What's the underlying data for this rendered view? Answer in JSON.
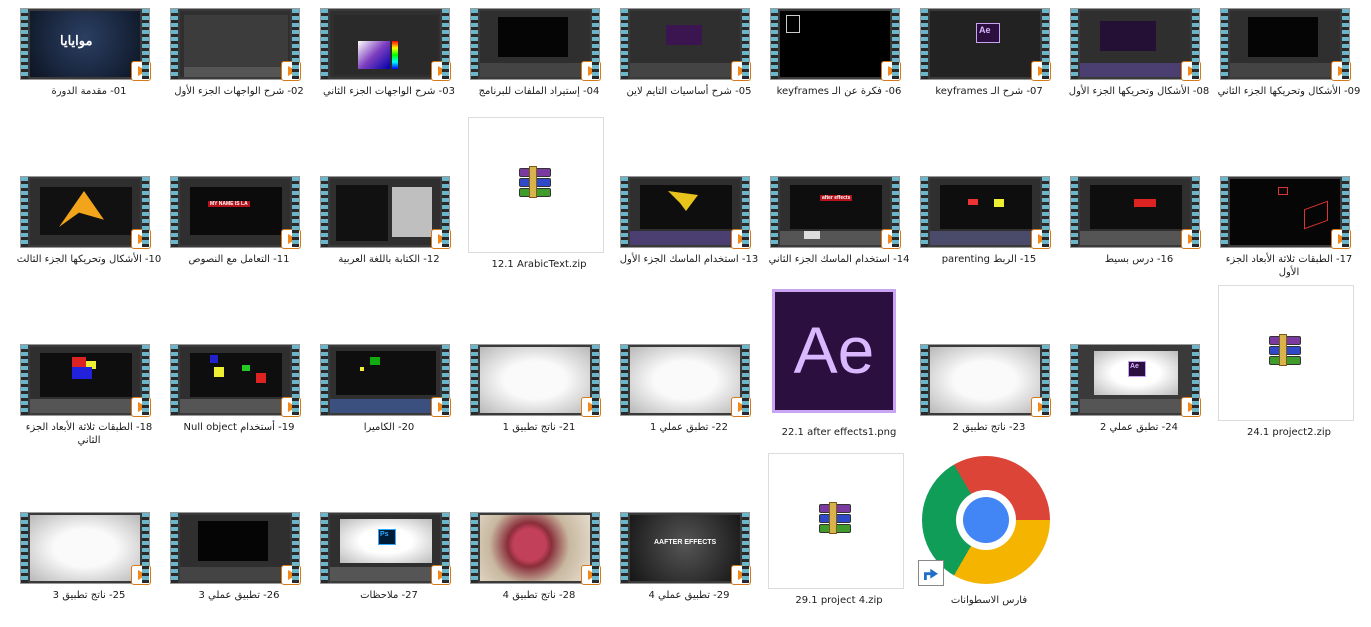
{
  "files": [
    {
      "name": "01- مقدمة الدورة",
      "type": "video",
      "theme": "title"
    },
    {
      "name": "02- شرح الواجهات الجزء الأول",
      "type": "video",
      "theme": "ui"
    },
    {
      "name": "03- شرح الواجهات الجزء الثاني",
      "type": "video",
      "theme": "color"
    },
    {
      "name": "04- إستيراد الملفات للبرنامج",
      "type": "video",
      "theme": "dark"
    },
    {
      "name": "05- شرح أساسيات التايم لاين",
      "type": "video",
      "theme": "purple"
    },
    {
      "name": "06- فكرة عن الـ keyframes",
      "type": "video",
      "theme": "black"
    },
    {
      "name": "07- شرح الـ keyframes",
      "type": "video",
      "theme": "ae"
    },
    {
      "name": "08- الأشكال وتحريكها الجزء الأول",
      "type": "video",
      "theme": "purple2"
    },
    {
      "name": "09- الأشكال وتحريكها الجزء الثاني",
      "type": "video",
      "theme": "dark"
    },
    {
      "name": "10- الأشكال وتحريكها الجزء الثالث",
      "type": "video",
      "theme": "yellow"
    },
    {
      "name": "11- التعامل مع النصوص",
      "type": "video",
      "theme": "redtext"
    },
    {
      "name": "12- الكتابة باللغة العربية",
      "type": "video",
      "theme": "gray"
    },
    {
      "name": "12.1 ArabicText.zip",
      "type": "zip"
    },
    {
      "name": "13- استخدام الماسك الجزء الأول",
      "type": "video",
      "theme": "yellow2"
    },
    {
      "name": "14- استخدام الماسك الجزء الثاني",
      "type": "video",
      "theme": "after"
    },
    {
      "name": "15- الربط parenting",
      "type": "video",
      "theme": "redyellow"
    },
    {
      "name": "16- درس بسيط",
      "type": "video",
      "theme": "redbar"
    },
    {
      "name": "17- الطبقات ثلاثة الأبعاد الجزء الأول",
      "type": "video",
      "theme": "3d"
    },
    {
      "name": "18- الطبقات ثلاثة الأبعاد الجزء الثاني",
      "type": "video",
      "theme": "blocks"
    },
    {
      "name": "19- أستخدام Null object",
      "type": "video",
      "theme": "blocks2"
    },
    {
      "name": "20- الكاميرا",
      "type": "video",
      "theme": "green"
    },
    {
      "name": "21- ناتج تطبيق 1",
      "type": "video",
      "theme": "white"
    },
    {
      "name": "22- تطبق عملي 1",
      "type": "video",
      "theme": "white"
    },
    {
      "name": "22.1 after effects1.png",
      "type": "ae"
    },
    {
      "name": "23- ناتج تطبيق 2",
      "type": "video",
      "theme": "white"
    },
    {
      "name": "24- تطبق عملي 2",
      "type": "video",
      "theme": "whiteae"
    },
    {
      "name": "24.1 project2.zip",
      "type": "zip"
    },
    {
      "name": "25- ناتج تطبيق 3",
      "type": "video",
      "theme": "white"
    },
    {
      "name": "26- تطبيق عملي 3",
      "type": "video",
      "theme": "dark"
    },
    {
      "name": "27- ملاحظات",
      "type": "video",
      "theme": "ps"
    },
    {
      "name": "28- ناتج تطبيق 4",
      "type": "video",
      "theme": "flower"
    },
    {
      "name": "29- تطبيق عملي 4",
      "type": "video",
      "theme": "aftereffects"
    },
    {
      "name": "29.1 project 4.zip",
      "type": "zip"
    },
    {
      "name": "فارس الاسطوانات",
      "type": "chrome"
    }
  ],
  "thumb_text": {
    "title": "موايايا",
    "redtext": "MY NAME IS LA",
    "after": "after effects",
    "aftereffects": "AAFTER EFFECTS",
    "ae": "Ae",
    "ps": "Ps"
  }
}
